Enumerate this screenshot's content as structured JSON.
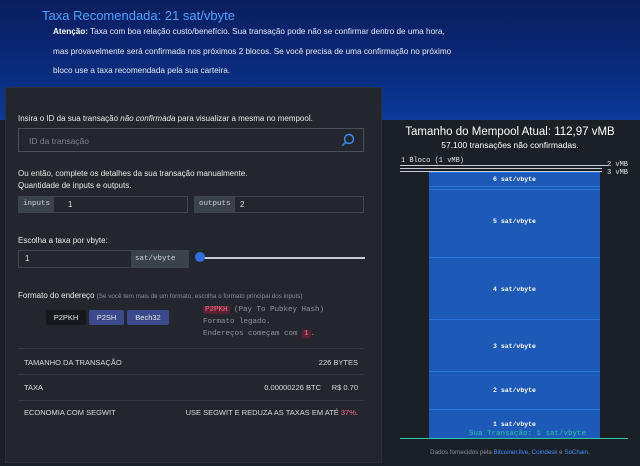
{
  "recommendation": {
    "title": "Taxa Recomendada: 21 sat/vbyte",
    "attention_label": "Atenção:",
    "text": "Taxa com boa relação custo/benefício. Sua transação pode não se confirmar dentro de uma hora, mas provavelmente será confirmada nos próximos 2 blocos. Se você precisa de uma confirmação no próximo bloco use a taxa recomendada pela sua carteira."
  },
  "form": {
    "lookup_prefix": "Insira o ID da sua transação ",
    "lookup_emph": "não confirmada",
    "lookup_suffix": " para visualizar a mesma no mempool.",
    "search_placeholder": "ID da transação",
    "manual_line1": "Ou então, complete os detalhes da sua transação manualmente.",
    "manual_line2": "Quantidade de inputs e outputs.",
    "inputs_label": "inputs",
    "inputs_value": "1",
    "outputs_label": "outputs",
    "outputs_value": "2",
    "fee_label": "Escolha a taxa por vbyte:",
    "fee_value": "1",
    "fee_unit": "sat/vbyte",
    "fee_slider_fraction": 0.0,
    "address_format_label": "Formato do endereço",
    "address_format_hint": "(Se você tem mais de um formato, escolha o formato principal dos inputs)",
    "formats": [
      "P2PKH",
      "P2SH",
      "Bech32"
    ],
    "selected_format": "P2PKH",
    "format_desc_tag": "P2PKH",
    "format_desc_name": "(Pay To Pubkey Hash)",
    "format_desc_line2": "Formato legado.",
    "format_desc_line3_prefix": "Endereços começam com ",
    "format_desc_line3_tag": "1",
    "format_desc_line3_suffix": "."
  },
  "summary": {
    "size_label": "TAMANHO DA TRANSAÇÃO",
    "size_value": "226 BYTES",
    "fee_label": "TAXA",
    "fee_btc": "0.00000226 BTC",
    "fee_brl": "R$ 0.70",
    "segwit_label": "ECONOMIA COM SEGWIT",
    "segwit_text": "USE SEGWIT E REDUZA AS TAXAS EM ATÉ ",
    "segwit_pct": "37%",
    "segwit_end": "."
  },
  "mempool": {
    "title": "Tamanho do Mempool Atual: 112,97 vMB",
    "subtitle": "57.100 transações não confirmadas.",
    "marker_1block": "1 Bloco (1 vMB)",
    "marker_2": "2 vMB",
    "marker_3": "3 vMB",
    "blocks": [
      "6 sat/vbyte",
      "5 sat/vbyte",
      "4 sat/vbyte",
      "3 sat/vbyte",
      "2 sat/vbyte",
      "1 sat/vbyte"
    ],
    "your_tx": "Sua Transação: 1 sat/vbyte",
    "footer_prefix": "Dados fornecidos pela ",
    "footer_link1": "Bitcoiner.live",
    "footer_sep1": ", ",
    "footer_link2": "Coindesk",
    "footer_sep2": " e ",
    "footer_link3": "SoChain",
    "footer_end": "."
  },
  "colors": {
    "accent": "#4aa3ff",
    "block_blue": "#1d5ab8",
    "highlight_red": "#ff6b8a",
    "your_tx_green": "#2ec4a6"
  },
  "icons": {
    "search": "search-icon"
  }
}
